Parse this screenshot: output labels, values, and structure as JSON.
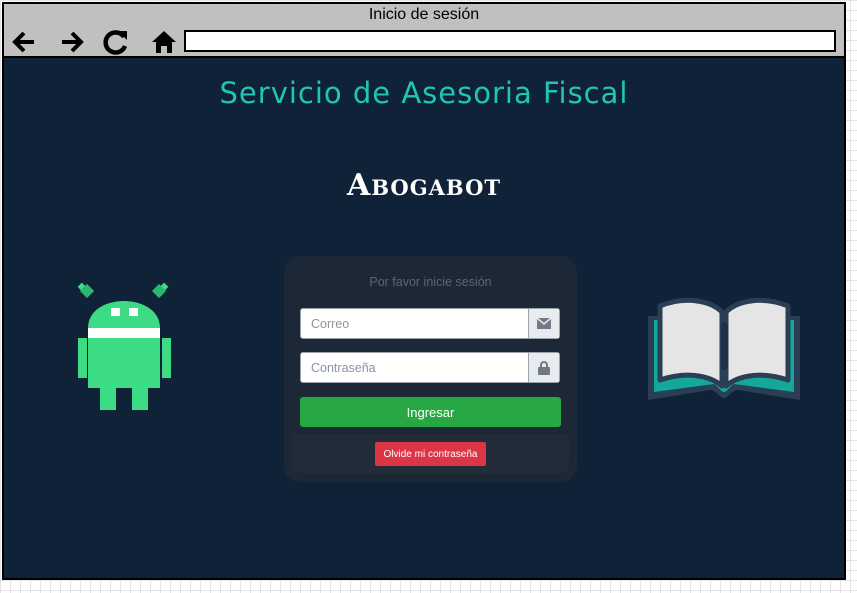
{
  "window": {
    "title": "Inicio de sesión",
    "address": ""
  },
  "nav": {
    "icons": [
      "back-arrow-icon",
      "forward-arrow-icon",
      "refresh-icon",
      "home-icon"
    ]
  },
  "page": {
    "service_title": "Servicio de Asesoria Fiscal",
    "brand": "Abogabot"
  },
  "login": {
    "heading": "Por favor inicie sesión",
    "email_placeholder": "Correo",
    "email_value": "",
    "email_icon": "envelope-icon",
    "password_placeholder": "Contraseña",
    "password_value": "",
    "password_icon": "lock-icon",
    "submit_label": "Ingresar",
    "forgot_label": "Olvide mi contraseña"
  },
  "illustrations": [
    "android-robot-icon",
    "open-book-icon"
  ],
  "colors": {
    "background": "#0f2237",
    "title_accent": "#1fc6b6",
    "robot": "#3ddc84",
    "book_accent": "#14a89b",
    "submit": "#28a745",
    "forgot": "#dc3545"
  }
}
